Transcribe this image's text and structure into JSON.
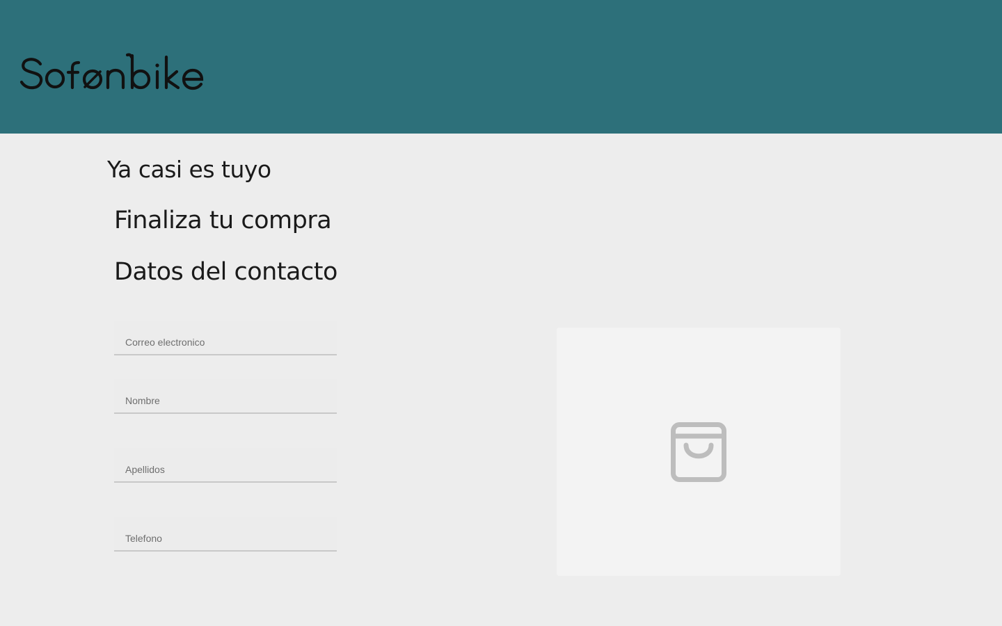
{
  "brand": {
    "logo_text": "Sofonbike",
    "header_color": "#2d707a"
  },
  "checkout": {
    "eyebrow": "Ya casi es tuyo",
    "title": "Finaliza tu compra",
    "section_title": "Datos del contacto"
  },
  "form": {
    "email_placeholder": "Correo electronico",
    "nombre_placeholder": "Nombre",
    "apellidos_placeholder": "Apellidos",
    "telefono_placeholder": "Telefono"
  },
  "cart": {
    "icon": "shopping-bag-icon",
    "icon_color": "#bdbdbd"
  }
}
